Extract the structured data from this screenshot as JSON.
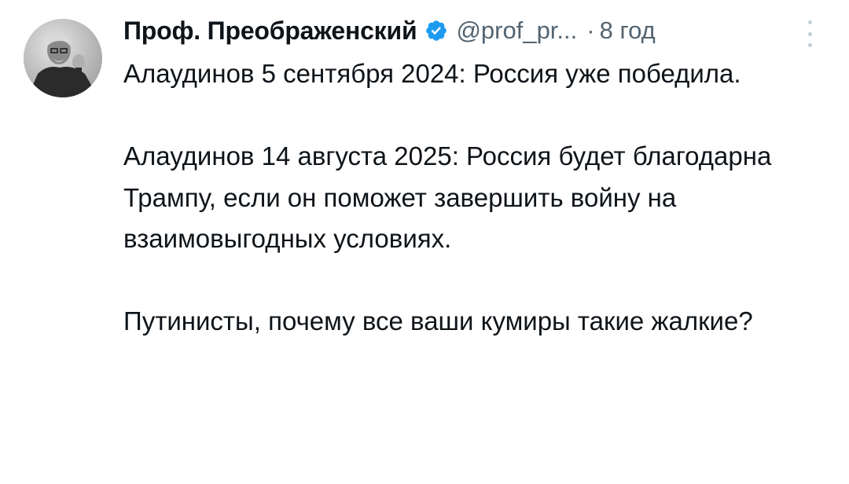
{
  "tweet": {
    "author": {
      "display_name": "Проф. Преображенский",
      "verified_icon": "verified-badge-icon",
      "handle": "@prof_pr...",
      "separator": "·",
      "time": "8 год"
    },
    "more_icon": "more-vertical-icon",
    "paragraphs": [
      "Алаудинов 5 сентября 2024: Россия уже победила.",
      "Алаудинов 14 августа 2025: Россия будет благодарна Трампу, если он поможет завершить войну на взаимовыгодных условиях.",
      "Путинисты, почему все ваши кумиры такие жалкие?"
    ]
  },
  "colors": {
    "text": "#0f1419",
    "secondary": "#536471",
    "verified": "#1d9bf0",
    "background": "#ffffff"
  }
}
